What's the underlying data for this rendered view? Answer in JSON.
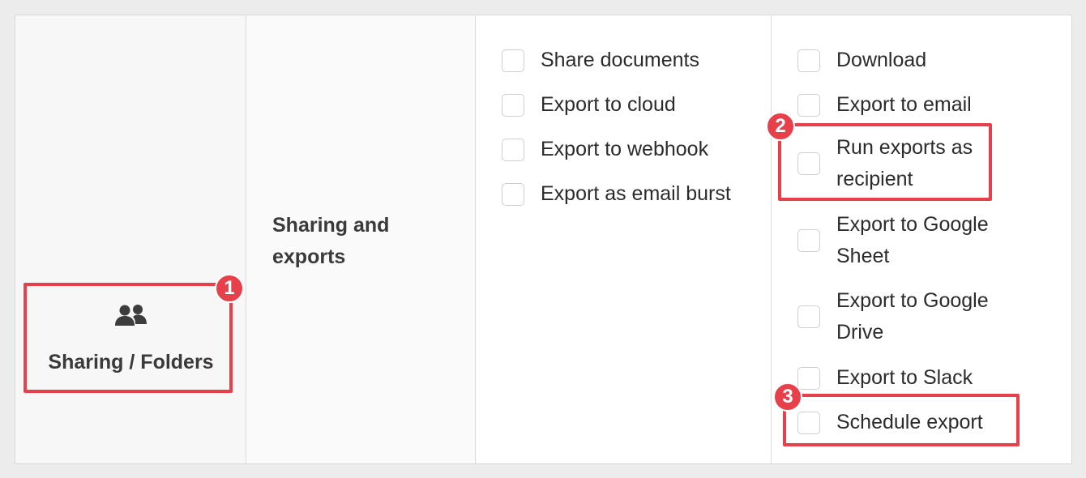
{
  "category": {
    "label": "Sharing / Folders",
    "icon": "users-icon"
  },
  "group": {
    "label": "Sharing and exports"
  },
  "permissions_left": [
    {
      "label": "Share documents"
    },
    {
      "label": "Export to cloud"
    },
    {
      "label": "Export to webhook"
    },
    {
      "label": "Export as email burst"
    }
  ],
  "permissions_right": [
    {
      "label": "Download"
    },
    {
      "label": "Export to email"
    },
    {
      "label": "Run exports as recipient"
    },
    {
      "label": "Export to Google Sheet"
    },
    {
      "label": "Export to Google Drive"
    },
    {
      "label": "Export to Slack"
    },
    {
      "label": "Schedule export"
    }
  ],
  "callouts": [
    {
      "number": "1"
    },
    {
      "number": "2"
    },
    {
      "number": "3"
    }
  ],
  "colors": {
    "callout": "#e8404a",
    "checkbox_border": "#cfcfcf",
    "text": "#2b2b2b"
  }
}
